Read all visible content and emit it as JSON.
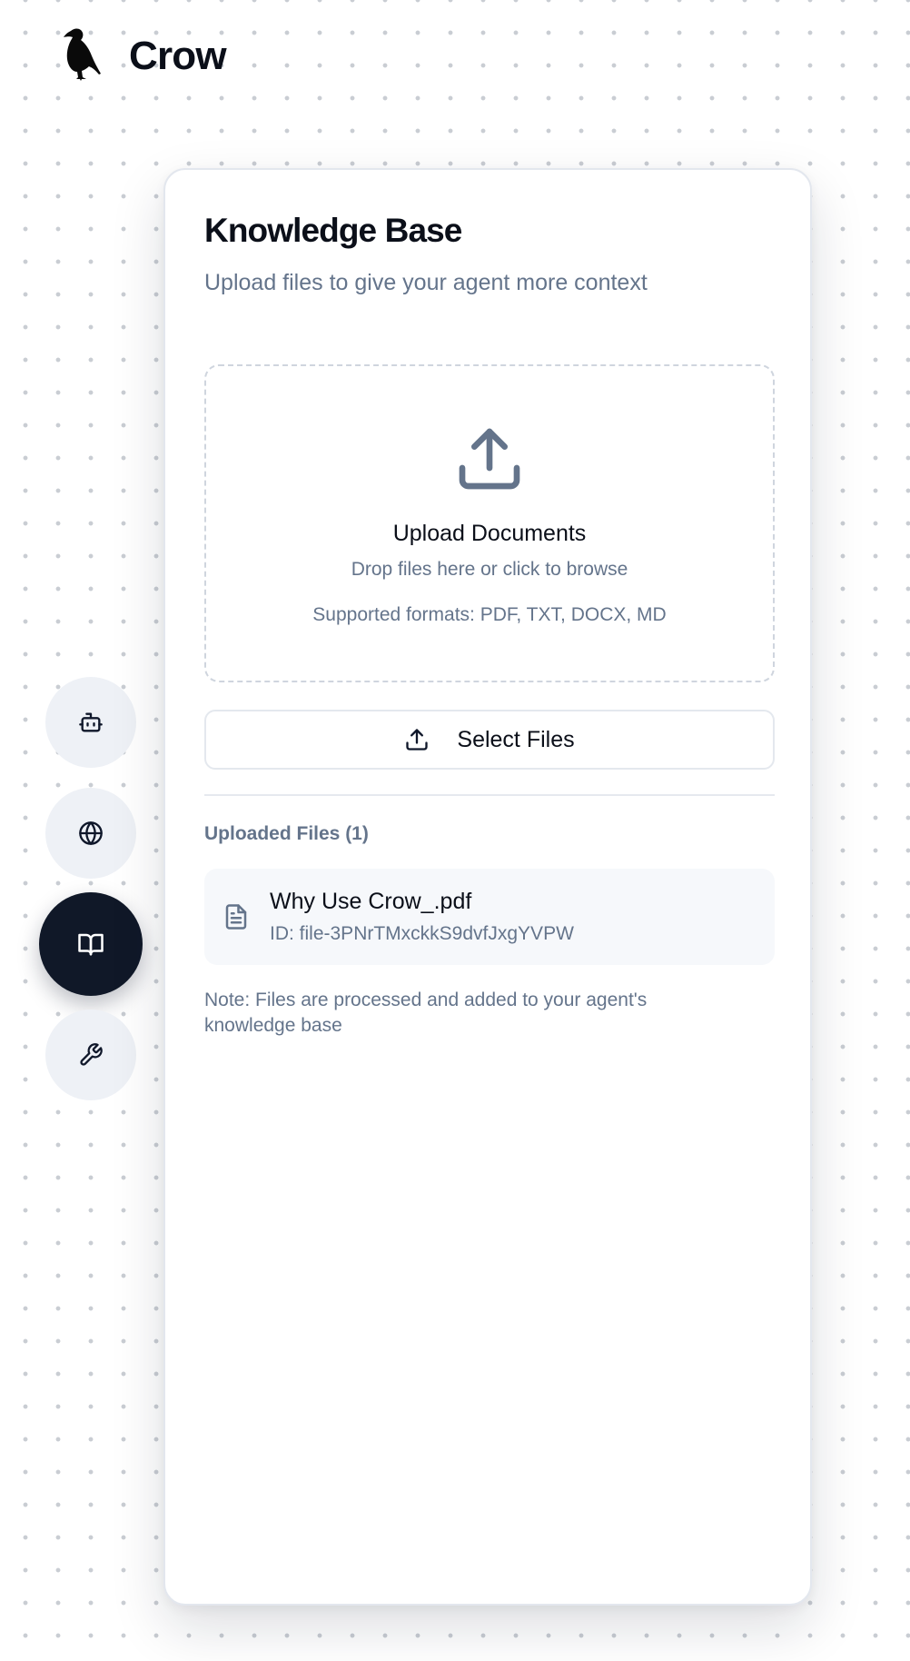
{
  "brand": {
    "name": "Crow",
    "logo_icon": "crow-icon"
  },
  "sidenav": {
    "items": [
      {
        "name": "agent",
        "icon": "bot-icon",
        "active": false
      },
      {
        "name": "web",
        "icon": "globe-icon",
        "active": false
      },
      {
        "name": "knowledge-base",
        "icon": "book-open-icon",
        "active": true
      },
      {
        "name": "tools",
        "icon": "wrench-icon",
        "active": false
      }
    ]
  },
  "panel": {
    "title": "Knowledge Base",
    "subtitle": "Upload files to give your agent more context",
    "dropzone": {
      "icon": "upload-icon",
      "title": "Upload Documents",
      "hint": "Drop files here or click to browse",
      "formats": "Supported formats: PDF, TXT, DOCX, MD"
    },
    "select_button_label": "Select Files",
    "uploaded_heading": "Uploaded Files (1)",
    "files": [
      {
        "name": "Why Use Crow_.pdf",
        "id": "ID: file-3PNrTMxckkS9dvfJxgYVPW",
        "icon": "file-text-icon"
      }
    ],
    "note": "Note: Files are processed and added to your agent's knowledge base"
  },
  "colors": {
    "accent_dark": "#101828",
    "muted_text": "#64748b",
    "nav_bg": "#eef1f6"
  }
}
